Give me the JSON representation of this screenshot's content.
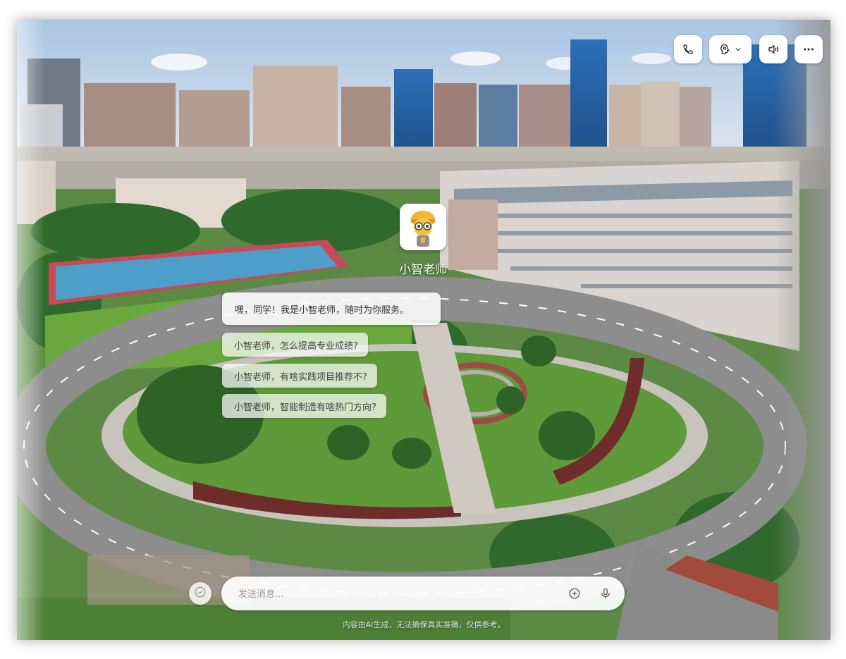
{
  "assistant": {
    "name": "小智老师",
    "greeting": "嘿，同学！我是小智老师，随时为你服务。"
  },
  "suggestions": [
    {
      "label": "小智老师，怎么提高专业成绩?"
    },
    {
      "label": "小智老师，有啥实践项目推荐不?"
    },
    {
      "label": "小智老师，智能制造有啥热门方向?"
    }
  ],
  "input": {
    "placeholder": "发送消息..."
  },
  "footer": {
    "disclaimer": "内容由AI生成，无法确保真实准确，仅供参考。"
  },
  "controls": {
    "icons": [
      "phone-icon",
      "voice-role-icon",
      "speaker-icon",
      "more-icon"
    ]
  }
}
